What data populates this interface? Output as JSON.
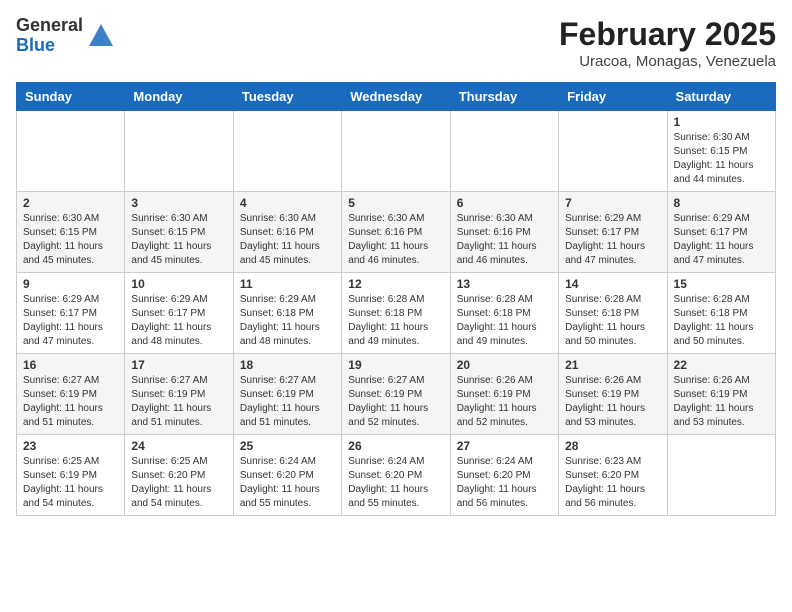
{
  "header": {
    "logo_general": "General",
    "logo_blue": "Blue",
    "month_title": "February 2025",
    "location": "Uracoa, Monagas, Venezuela"
  },
  "weekdays": [
    "Sunday",
    "Monday",
    "Tuesday",
    "Wednesday",
    "Thursday",
    "Friday",
    "Saturday"
  ],
  "weeks": [
    [
      {
        "day": "",
        "info": ""
      },
      {
        "day": "",
        "info": ""
      },
      {
        "day": "",
        "info": ""
      },
      {
        "day": "",
        "info": ""
      },
      {
        "day": "",
        "info": ""
      },
      {
        "day": "",
        "info": ""
      },
      {
        "day": "1",
        "info": "Sunrise: 6:30 AM\nSunset: 6:15 PM\nDaylight: 11 hours\nand 44 minutes."
      }
    ],
    [
      {
        "day": "2",
        "info": "Sunrise: 6:30 AM\nSunset: 6:15 PM\nDaylight: 11 hours\nand 45 minutes."
      },
      {
        "day": "3",
        "info": "Sunrise: 6:30 AM\nSunset: 6:15 PM\nDaylight: 11 hours\nand 45 minutes."
      },
      {
        "day": "4",
        "info": "Sunrise: 6:30 AM\nSunset: 6:16 PM\nDaylight: 11 hours\nand 45 minutes."
      },
      {
        "day": "5",
        "info": "Sunrise: 6:30 AM\nSunset: 6:16 PM\nDaylight: 11 hours\nand 46 minutes."
      },
      {
        "day": "6",
        "info": "Sunrise: 6:30 AM\nSunset: 6:16 PM\nDaylight: 11 hours\nand 46 minutes."
      },
      {
        "day": "7",
        "info": "Sunrise: 6:29 AM\nSunset: 6:17 PM\nDaylight: 11 hours\nand 47 minutes."
      },
      {
        "day": "8",
        "info": "Sunrise: 6:29 AM\nSunset: 6:17 PM\nDaylight: 11 hours\nand 47 minutes."
      }
    ],
    [
      {
        "day": "9",
        "info": "Sunrise: 6:29 AM\nSunset: 6:17 PM\nDaylight: 11 hours\nand 47 minutes."
      },
      {
        "day": "10",
        "info": "Sunrise: 6:29 AM\nSunset: 6:17 PM\nDaylight: 11 hours\nand 48 minutes."
      },
      {
        "day": "11",
        "info": "Sunrise: 6:29 AM\nSunset: 6:18 PM\nDaylight: 11 hours\nand 48 minutes."
      },
      {
        "day": "12",
        "info": "Sunrise: 6:28 AM\nSunset: 6:18 PM\nDaylight: 11 hours\nand 49 minutes."
      },
      {
        "day": "13",
        "info": "Sunrise: 6:28 AM\nSunset: 6:18 PM\nDaylight: 11 hours\nand 49 minutes."
      },
      {
        "day": "14",
        "info": "Sunrise: 6:28 AM\nSunset: 6:18 PM\nDaylight: 11 hours\nand 50 minutes."
      },
      {
        "day": "15",
        "info": "Sunrise: 6:28 AM\nSunset: 6:18 PM\nDaylight: 11 hours\nand 50 minutes."
      }
    ],
    [
      {
        "day": "16",
        "info": "Sunrise: 6:27 AM\nSunset: 6:19 PM\nDaylight: 11 hours\nand 51 minutes."
      },
      {
        "day": "17",
        "info": "Sunrise: 6:27 AM\nSunset: 6:19 PM\nDaylight: 11 hours\nand 51 minutes."
      },
      {
        "day": "18",
        "info": "Sunrise: 6:27 AM\nSunset: 6:19 PM\nDaylight: 11 hours\nand 51 minutes."
      },
      {
        "day": "19",
        "info": "Sunrise: 6:27 AM\nSunset: 6:19 PM\nDaylight: 11 hours\nand 52 minutes."
      },
      {
        "day": "20",
        "info": "Sunrise: 6:26 AM\nSunset: 6:19 PM\nDaylight: 11 hours\nand 52 minutes."
      },
      {
        "day": "21",
        "info": "Sunrise: 6:26 AM\nSunset: 6:19 PM\nDaylight: 11 hours\nand 53 minutes."
      },
      {
        "day": "22",
        "info": "Sunrise: 6:26 AM\nSunset: 6:19 PM\nDaylight: 11 hours\nand 53 minutes."
      }
    ],
    [
      {
        "day": "23",
        "info": "Sunrise: 6:25 AM\nSunset: 6:19 PM\nDaylight: 11 hours\nand 54 minutes."
      },
      {
        "day": "24",
        "info": "Sunrise: 6:25 AM\nSunset: 6:20 PM\nDaylight: 11 hours\nand 54 minutes."
      },
      {
        "day": "25",
        "info": "Sunrise: 6:24 AM\nSunset: 6:20 PM\nDaylight: 11 hours\nand 55 minutes."
      },
      {
        "day": "26",
        "info": "Sunrise: 6:24 AM\nSunset: 6:20 PM\nDaylight: 11 hours\nand 55 minutes."
      },
      {
        "day": "27",
        "info": "Sunrise: 6:24 AM\nSunset: 6:20 PM\nDaylight: 11 hours\nand 56 minutes."
      },
      {
        "day": "28",
        "info": "Sunrise: 6:23 AM\nSunset: 6:20 PM\nDaylight: 11 hours\nand 56 minutes."
      },
      {
        "day": "",
        "info": ""
      }
    ]
  ]
}
